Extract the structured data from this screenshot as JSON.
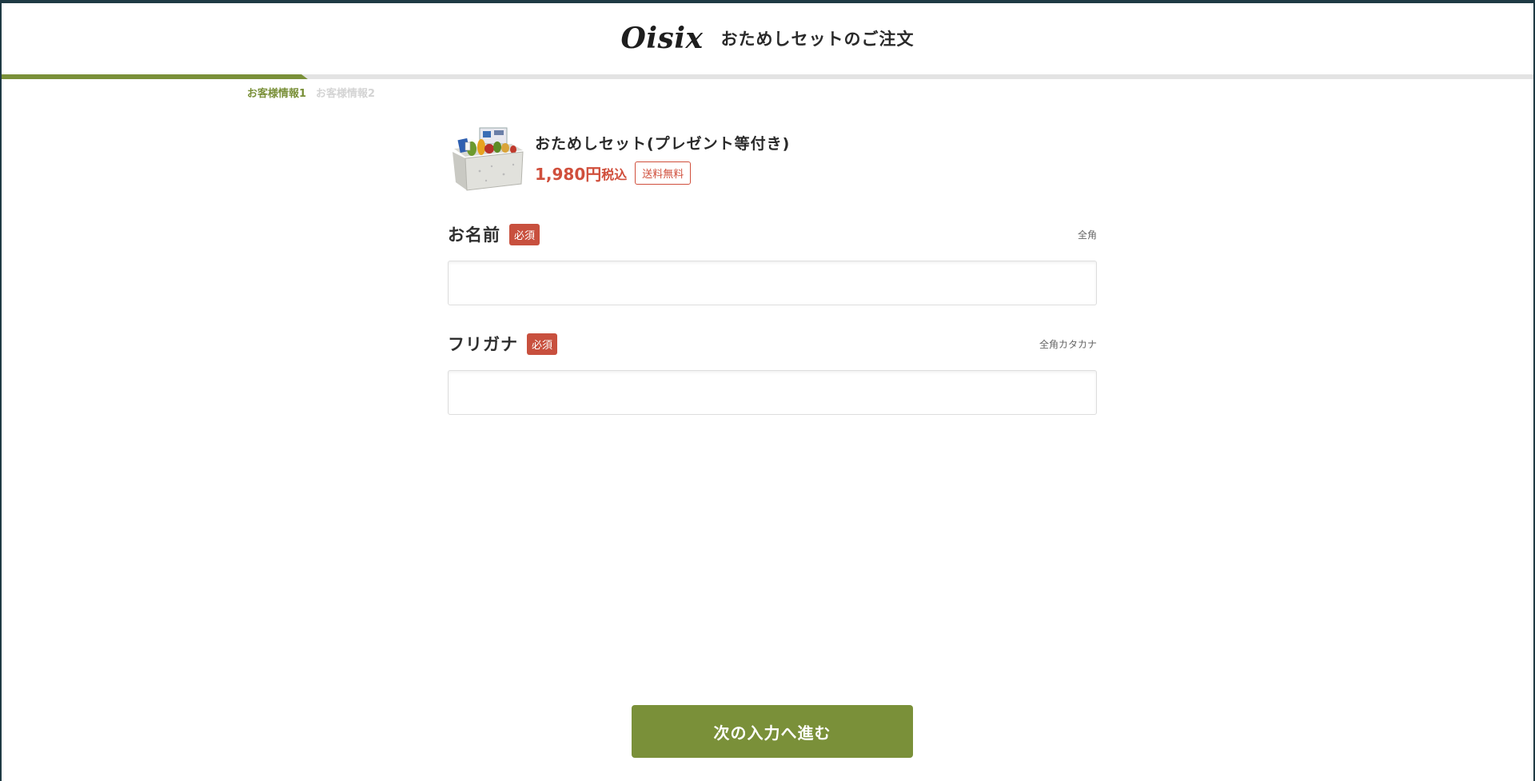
{
  "header": {
    "logo": "Oisix",
    "title": "おためしセットのご注文"
  },
  "progress": {
    "value": 0.2,
    "steps": [
      {
        "label": "お客様情報1",
        "active": true
      },
      {
        "label": "お客様情報2",
        "active": false
      }
    ]
  },
  "product": {
    "name": "おためしセット(プレゼント等付き)",
    "price": "1,980円",
    "tax_label": "税込",
    "shipping_badge": "送料無料"
  },
  "form": {
    "name": {
      "label": "お名前",
      "required_badge": "必須",
      "hint": "全角",
      "value": "",
      "placeholder": ""
    },
    "furigana": {
      "label": "フリガナ",
      "required_badge": "必須",
      "hint": "全角カタカナ",
      "value": "",
      "placeholder": ""
    }
  },
  "actions": {
    "next_label": "次の入力へ進む"
  },
  "colors": {
    "accent_green": "#7a9039",
    "price_red": "#d04f3c",
    "required_red": "#c8503e",
    "top_bar": "#1f3a44"
  }
}
